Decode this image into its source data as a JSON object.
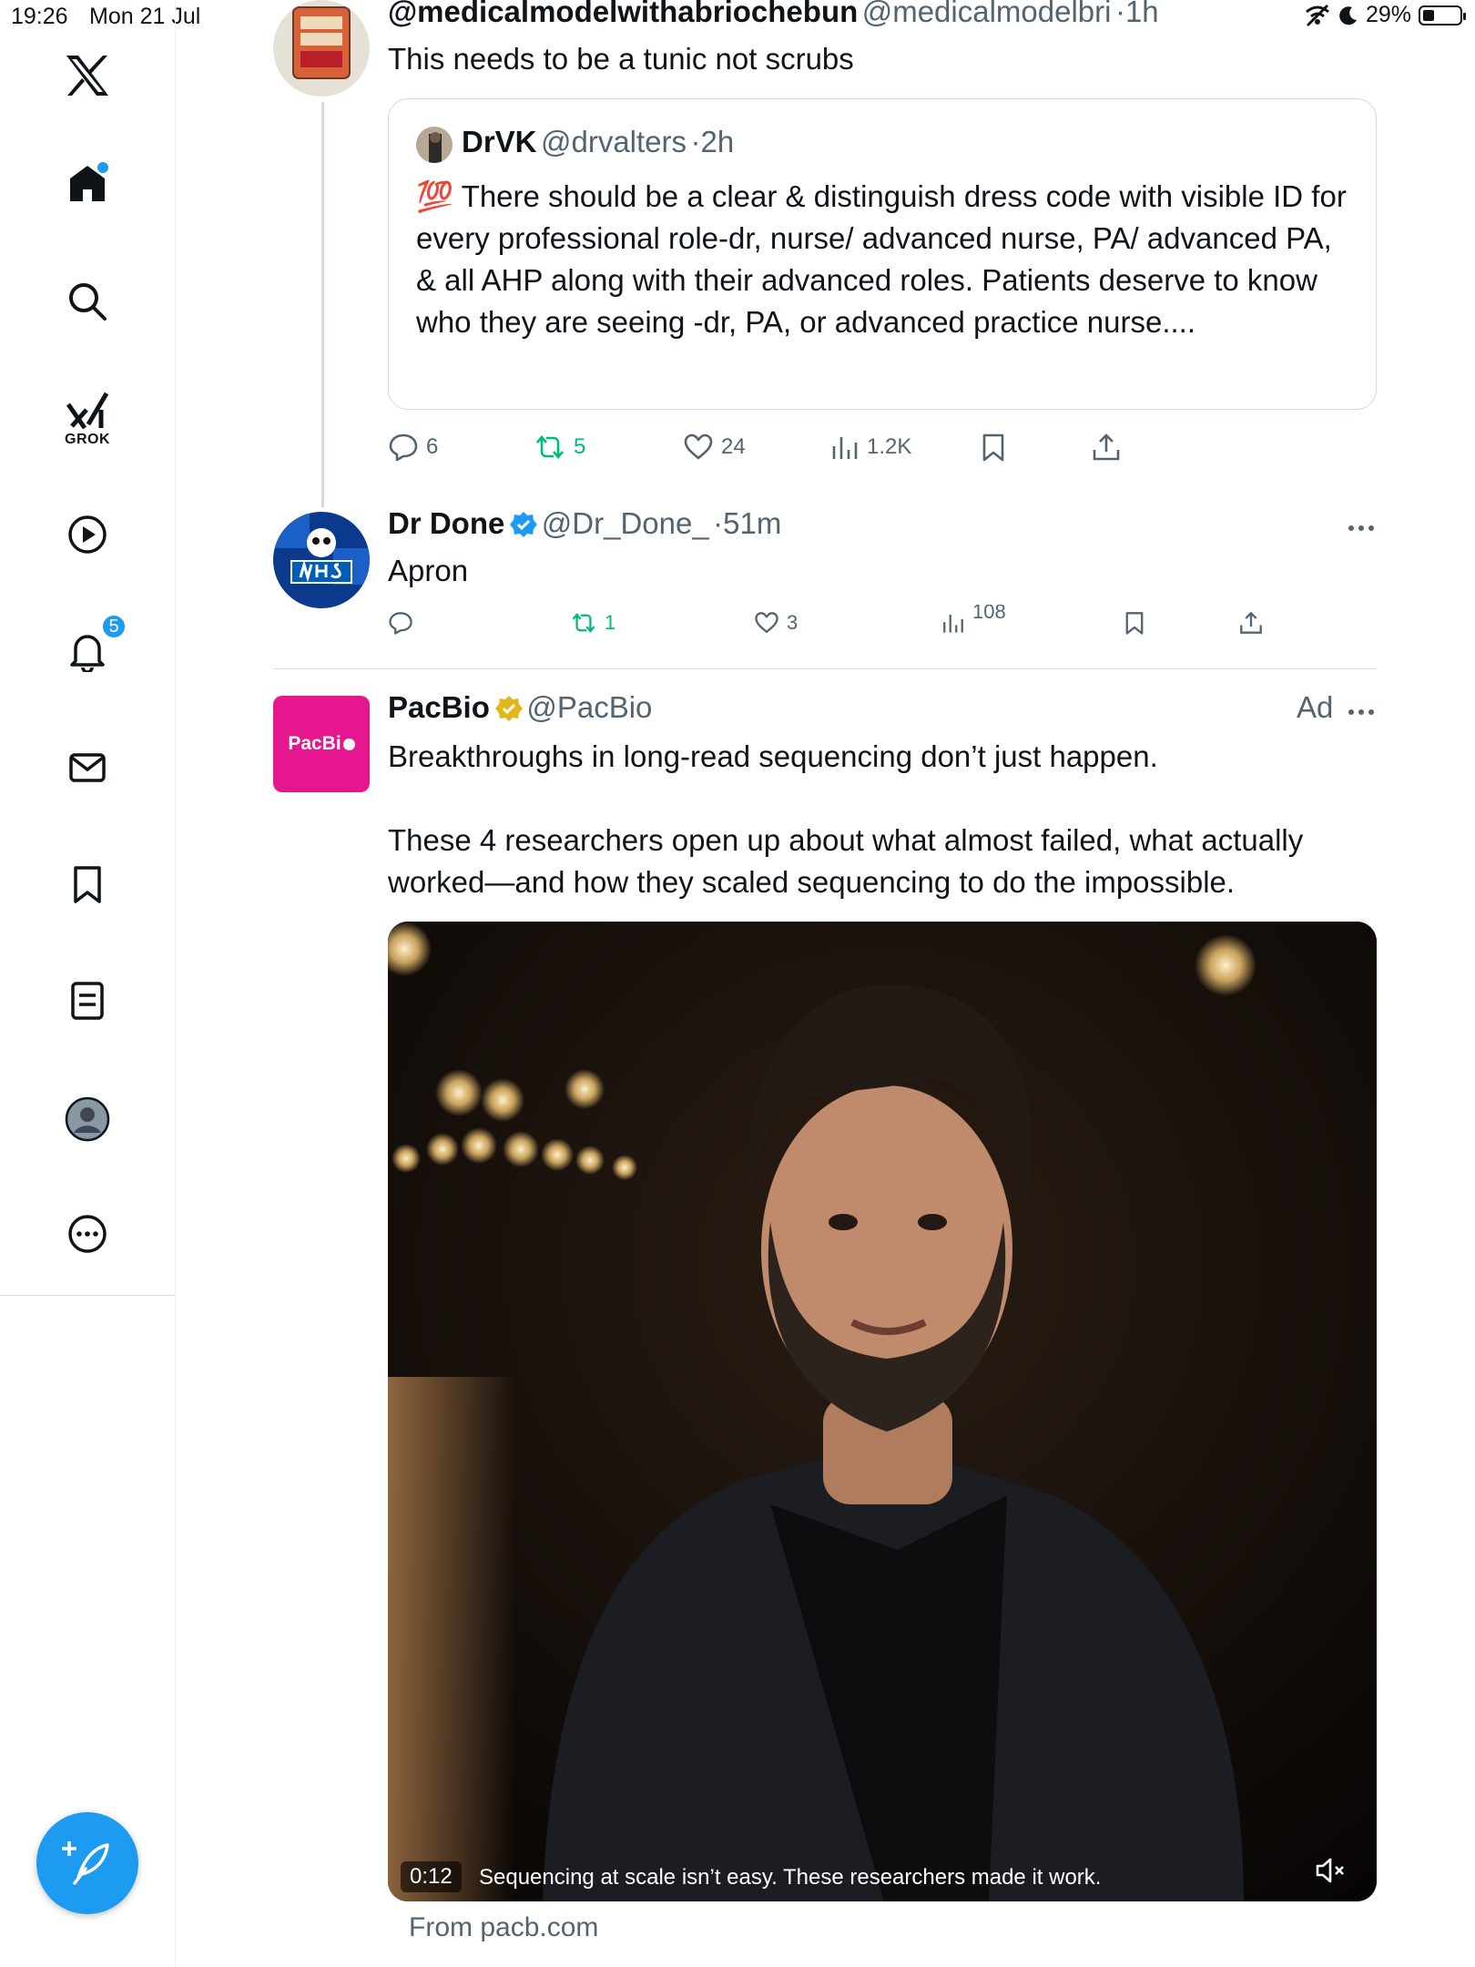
{
  "status_bar": {
    "time": "19:26",
    "date": "Mon 21 Jul",
    "battery": "29%",
    "battery_level": 0.29
  },
  "sidebar": {
    "items": [
      {
        "name": "home",
        "icon": "home-icon"
      },
      {
        "name": "search",
        "icon": "search-icon"
      },
      {
        "name": "grok",
        "icon": "grok-icon",
        "label": "GROK"
      },
      {
        "name": "video",
        "icon": "play-icon"
      },
      {
        "name": "notifications",
        "icon": "bell-icon",
        "badge": "5"
      },
      {
        "name": "messages",
        "icon": "mail-icon"
      },
      {
        "name": "bookmarks",
        "icon": "bookmark-icon"
      },
      {
        "name": "lists",
        "icon": "list-icon"
      },
      {
        "name": "profile",
        "icon": "profile-icon"
      },
      {
        "name": "more",
        "icon": "more-icon"
      }
    ],
    "compose_icon": "compose-icon"
  },
  "posts": [
    {
      "name": "@medicalmodelwithabriochebun",
      "handle": "@medicalmodelbri",
      "time": "1h",
      "text": "This needs to be a tunic not scrubs",
      "quote": {
        "name": "DrVK",
        "handle": "@drvalters",
        "time": "2h",
        "emoji": "💯",
        "text": "There should be a clear & distinguish dress code with visible ID for every professional role-dr, nurse/ advanced nurse, PA/ advanced PA, & all AHP along with their advanced roles. Patients deserve to know who they are seeing -dr, PA, or advanced practice nurse...."
      },
      "actions": {
        "replies": "6",
        "reposts": "5",
        "likes": "24",
        "views": "1.2K"
      }
    },
    {
      "name": "Dr Done",
      "handle": "@Dr_Done_",
      "time": "51m",
      "text": "Apron",
      "actions": {
        "replies": "",
        "reposts": "1",
        "likes": "3",
        "views": "108"
      }
    },
    {
      "name": "PacBio",
      "handle": "@PacBio",
      "ad_label": "Ad",
      "avatar_text": "PacBi",
      "text_1": "Breakthroughs in long-read sequencing don’t just happen.",
      "text_2": "These 4 researchers open up about what almost failed, what actually worked—and how they scaled sequencing to do the impossible.",
      "video": {
        "time": "0:12",
        "caption": "Sequencing at scale isn’t easy. These researchers made it work."
      },
      "from": "From pacb.com"
    }
  ],
  "colors": {
    "accent": "#1d9bf0",
    "repost": "#00ba7c",
    "text_secondary": "#536471",
    "pacbio_pink": "#e6168f",
    "gold_check": "#e2b719"
  },
  "separator": "·"
}
